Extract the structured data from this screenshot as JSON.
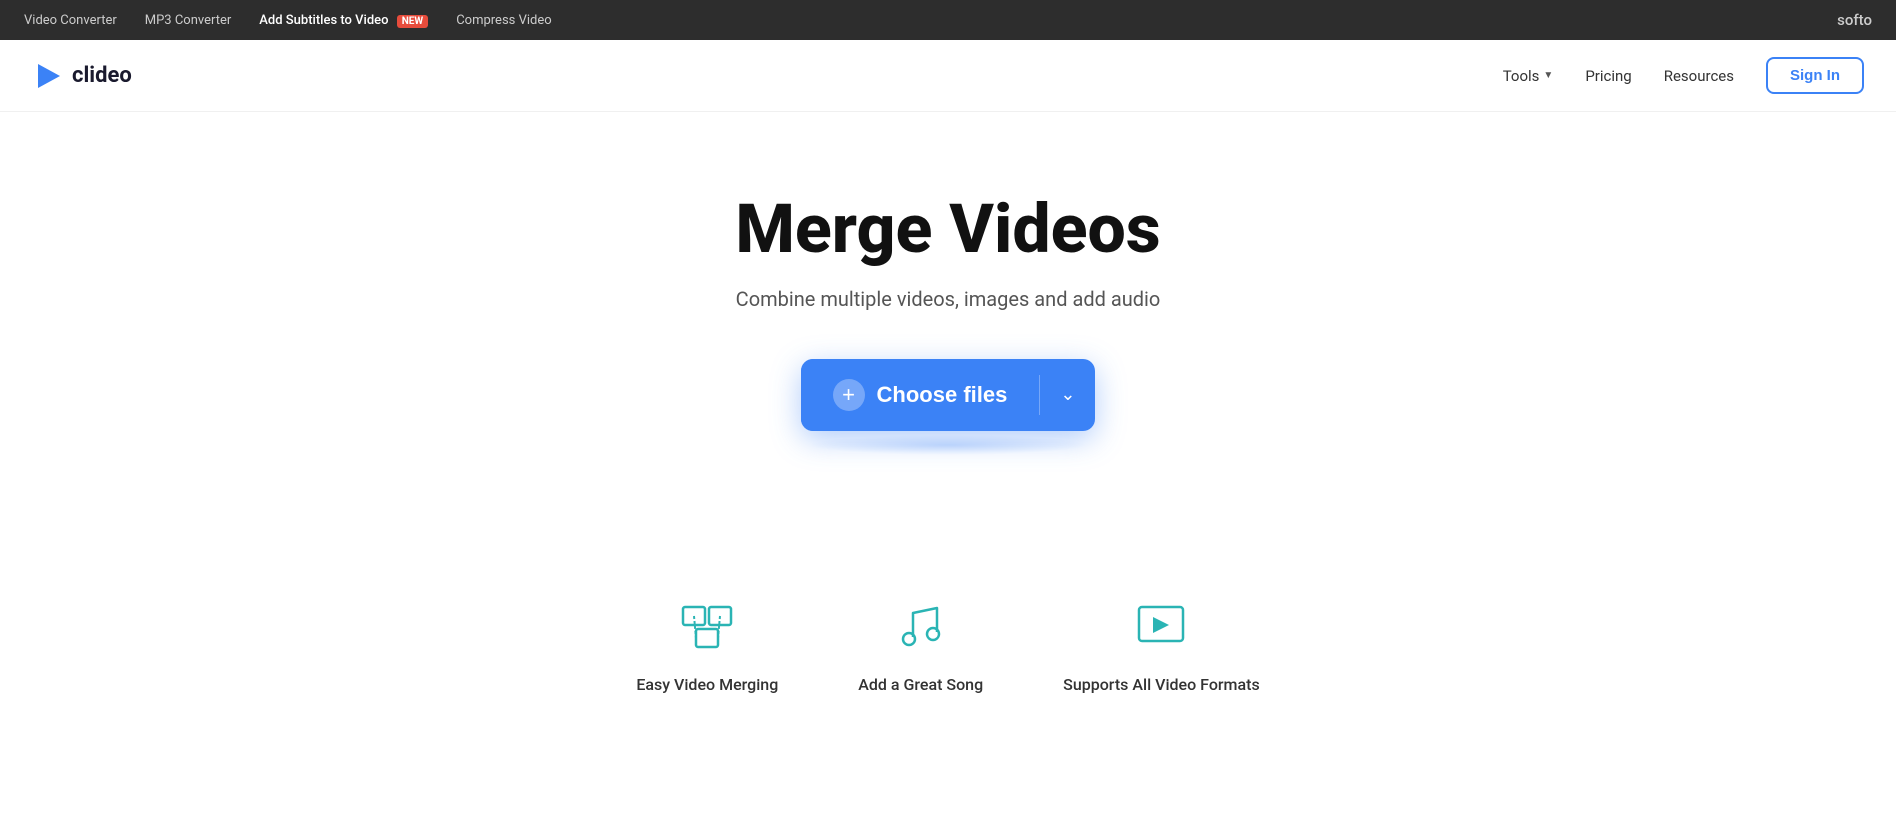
{
  "topbar": {
    "links": [
      {
        "label": "Video Converter",
        "active": false
      },
      {
        "label": "MP3 Converter",
        "active": false
      },
      {
        "label": "Add Subtitles to Video",
        "active": true,
        "badge": "NEW"
      },
      {
        "label": "Compress Video",
        "active": false
      }
    ],
    "brand": "softo"
  },
  "navbar": {
    "logo_text": "clideo",
    "tools_label": "Tools",
    "pricing_label": "Pricing",
    "resources_label": "Resources",
    "signin_label": "Sign In"
  },
  "hero": {
    "title": "Merge Videos",
    "subtitle": "Combine multiple videos, images and add audio",
    "choose_files_label": "Choose files"
  },
  "features": [
    {
      "name": "easy-video-merging",
      "icon": "merge-icon",
      "label": "Easy Video Merging"
    },
    {
      "name": "add-great-song",
      "icon": "music-icon",
      "label": "Add a Great Song"
    },
    {
      "name": "supports-all-formats",
      "icon": "formats-icon",
      "label": "Supports All Video Formats"
    }
  ]
}
